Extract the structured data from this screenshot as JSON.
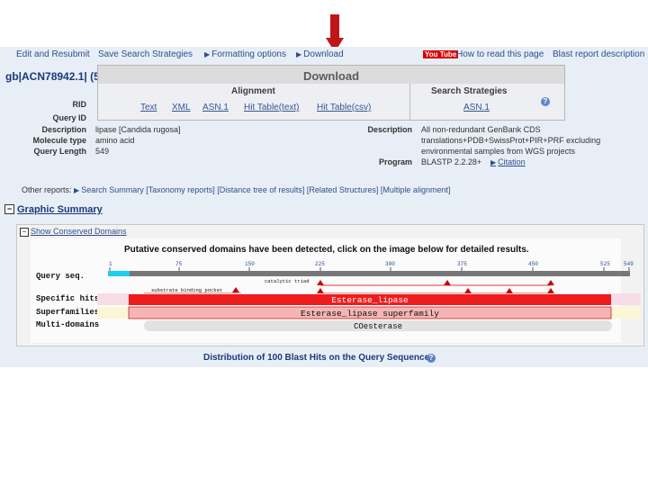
{
  "top_links": {
    "edit_resubmit": "Edit and Resubmit",
    "save_strategies": "Save Search Strategies",
    "formatting_options": "Formatting options",
    "download": "Download",
    "youtube_badge": "You Tube",
    "how_to_read": "How to read this page",
    "blast_report_description": "Blast report description"
  },
  "title": "gb|ACN78942.1| (5",
  "download_panel": {
    "title": "Download",
    "alignment_header": "Alignment",
    "alignment_links": [
      "Text",
      "XML",
      "ASN.1",
      "Hit Table(text)",
      "Hit Table(csv)"
    ],
    "strategies_header": "Search Strategies",
    "strategies_link": "ASN.1"
  },
  "details": {
    "rid_label": "RID",
    "query_id_label": "Query ID",
    "description_label": "Description",
    "description_value": "lipase [Candida rugosa]",
    "molecule_type_label": "Molecule type",
    "molecule_type_value": "amino acid",
    "query_length_label": "Query Length",
    "query_length_value": "549",
    "db_description_label": "Description",
    "db_description_lines": [
      "All non-redundant GenBank CDS",
      "translations+PDB+SwissProt+PIR+PRF excluding",
      "environmental samples from WGS projects"
    ],
    "program_label": "Program",
    "program_value": "BLASTP 2.2.28+",
    "citation_link": "Citation"
  },
  "other_reports": {
    "label": "Other reports:",
    "links": [
      "Search Summary",
      "[Taxonomy reports]",
      "[Distance tree of results]",
      "[Related Structures]",
      "[Multiple alignment]"
    ]
  },
  "graphic_summary": {
    "title": "Graphic Summary",
    "show_conserved_domains": "Show Conserved Domains",
    "notice": "Putative conserved domains have been detected, click on the image below for detailed results.",
    "query_seq_label": "Query seq.",
    "ticks": [
      "1",
      "75",
      "150",
      "225",
      "300",
      "375",
      "450",
      "525",
      "549"
    ],
    "track_labels": {
      "specific": "Specific hits",
      "superfamilies": "Superfamilies",
      "multidomains": "Multi-domains"
    },
    "features": {
      "binding_pocket": "substrate binding pocket",
      "catalytic_triad": "catalytic triad"
    },
    "specific_hit": "Esterase_lipase",
    "superfamily": "Esterase_lipase superfamily",
    "multidomain": "COesterase"
  },
  "distribution_title": "Distribution of 100 Blast Hits on the Query Sequence",
  "colors": {
    "link": "#2d4f8c",
    "specific_hit": "#ee1c1c",
    "superfamily": "#f5b5b5",
    "arrow": "#c0161a",
    "query_cyan": "#22ccee"
  }
}
